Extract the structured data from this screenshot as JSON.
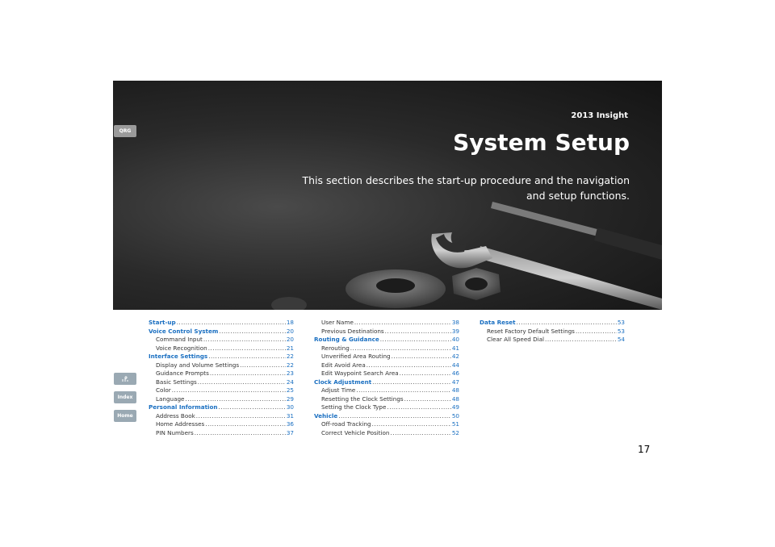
{
  "header": {
    "model": "2013 Insight",
    "title": "System Setup",
    "description": "This section describes the start-up procedure and the navigation and setup functions."
  },
  "side_nav": {
    "qrg_label": "QRG",
    "toc_icon": "toc-icon",
    "index_label": "Index",
    "home_label": "Home"
  },
  "toc": {
    "col1": [
      {
        "label": "Start-up",
        "page": "18",
        "level": "head"
      },
      {
        "label": "Voice Control System",
        "page": "20",
        "level": "head"
      },
      {
        "label": "Command Input",
        "page": "20",
        "level": "sub"
      },
      {
        "label": "Voice Recognition",
        "page": "21",
        "level": "sub"
      },
      {
        "label": "Interface Settings",
        "page": "22",
        "level": "head"
      },
      {
        "label": "Display and Volume Settings",
        "page": "22",
        "level": "sub"
      },
      {
        "label": "Guidance Prompts",
        "page": "23",
        "level": "sub"
      },
      {
        "label": "Basic Settings",
        "page": "24",
        "level": "sub"
      },
      {
        "label": "Color",
        "page": "25",
        "level": "sub"
      },
      {
        "label": "Language",
        "page": "29",
        "level": "sub"
      },
      {
        "label": "Personal Information",
        "page": "30",
        "level": "head"
      },
      {
        "label": "Address Book",
        "page": "31",
        "level": "sub"
      },
      {
        "label": "Home Addresses",
        "page": "36",
        "level": "sub"
      },
      {
        "label": "PIN Numbers",
        "page": "37",
        "level": "sub"
      }
    ],
    "col2": [
      {
        "label": "User Name",
        "page": "38",
        "level": "sub"
      },
      {
        "label": "Previous Destinations",
        "page": "39",
        "level": "sub"
      },
      {
        "label": "Routing & Guidance",
        "page": "40",
        "level": "head"
      },
      {
        "label": "Rerouting",
        "page": "41",
        "level": "sub"
      },
      {
        "label": "Unverified Area Routing",
        "page": "42",
        "level": "sub"
      },
      {
        "label": "Edit Avoid Area",
        "page": "44",
        "level": "sub"
      },
      {
        "label": "Edit Waypoint Search Area",
        "page": "46",
        "level": "sub"
      },
      {
        "label": "Clock Adjustment",
        "page": "47",
        "level": "head"
      },
      {
        "label": "Adjust Time",
        "page": "48",
        "level": "sub"
      },
      {
        "label": "Resetting the Clock Settings",
        "page": "48",
        "level": "sub"
      },
      {
        "label": "Setting the Clock Type",
        "page": "49",
        "level": "sub"
      },
      {
        "label": "Vehicle",
        "page": "50",
        "level": "head"
      },
      {
        "label": "Off-road Tracking",
        "page": "51",
        "level": "sub"
      },
      {
        "label": "Correct Vehicle Position",
        "page": "52",
        "level": "sub"
      }
    ],
    "col3": [
      {
        "label": "Data Reset",
        "page": "53",
        "level": "head"
      },
      {
        "label": "Reset Factory Default Settings",
        "page": "53",
        "level": "sub"
      },
      {
        "label": "Clear All Speed Dial",
        "page": "54",
        "level": "sub"
      }
    ]
  },
  "page_number": "17"
}
